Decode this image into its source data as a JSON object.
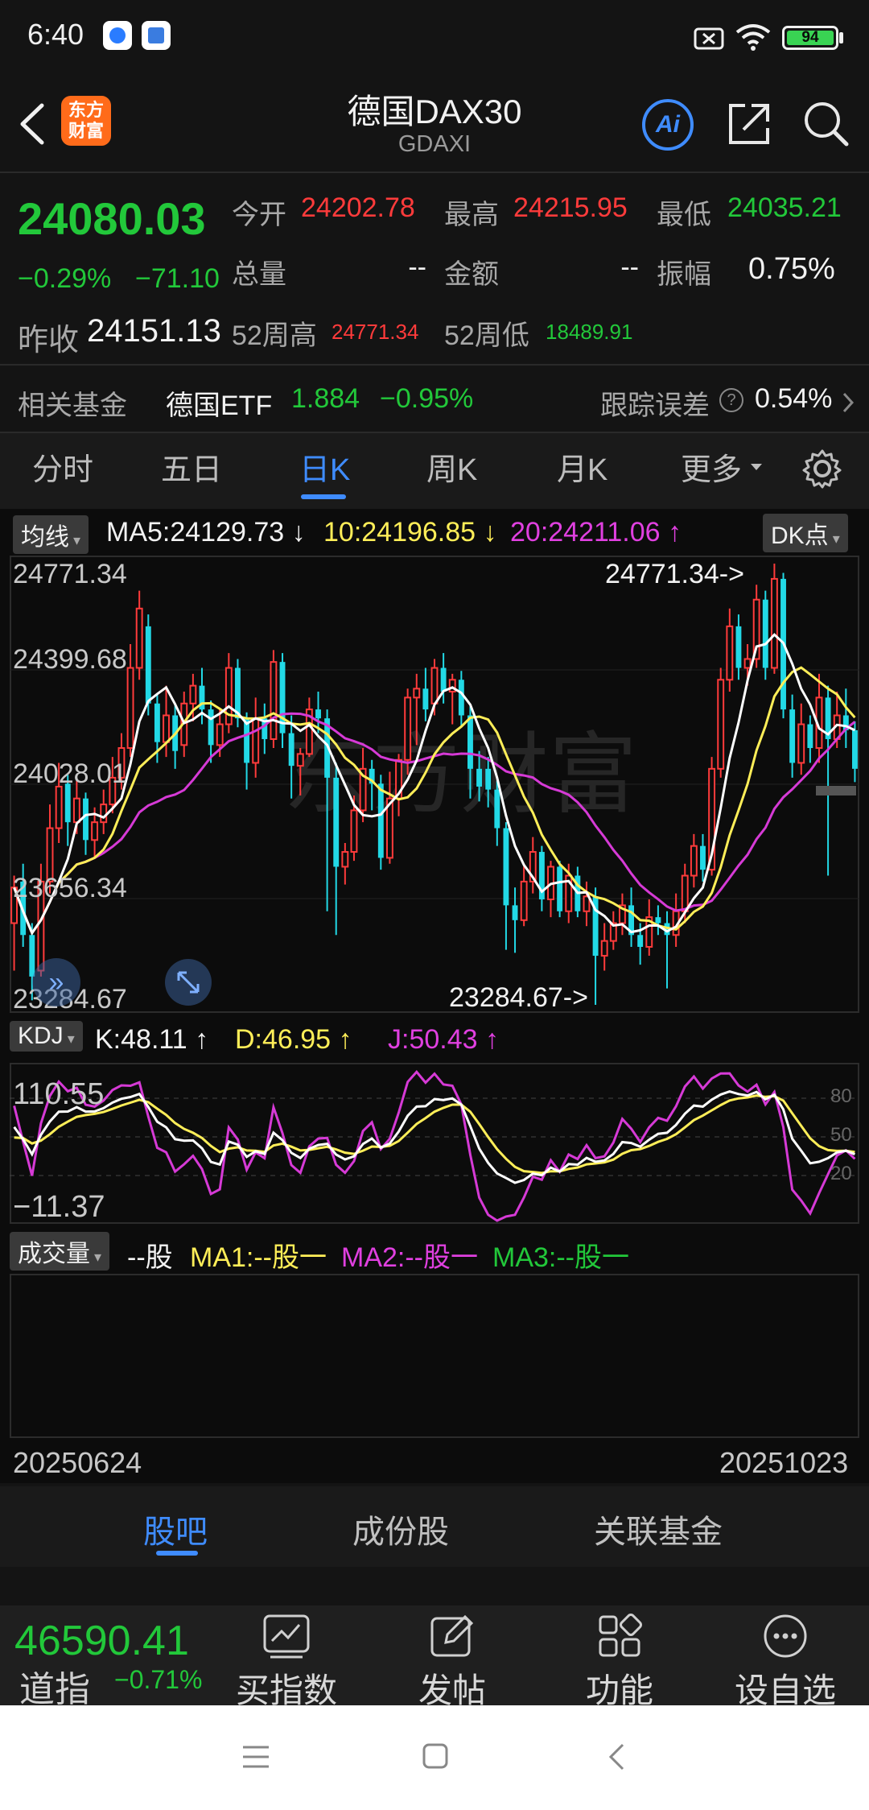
{
  "status_bar": {
    "time": "6:40",
    "battery": "94",
    "icons": [
      "sim-x-icon",
      "wifi-icon",
      "battery-icon"
    ]
  },
  "header": {
    "logo_text": "东方财富",
    "title": "德国DAX30",
    "subtitle": "GDAXI",
    "ai_label": "Ai",
    "icons": [
      "back-icon",
      "share-icon",
      "search-icon"
    ]
  },
  "quote": {
    "price": "24080.03",
    "change_pct": "−0.29%",
    "change": "−71.10",
    "prev_close_label": "昨收",
    "prev_close": "24151.13",
    "open_label": "今开",
    "open": "24202.78",
    "high_label": "最高",
    "high": "24215.95",
    "low_label": "最低",
    "low": "24035.21",
    "volume_label": "总量",
    "volume": "--",
    "amount_label": "金额",
    "amount": "--",
    "amplitude_label": "振幅",
    "amplitude": "0.75%",
    "w52_high_label": "52周高",
    "w52_high": "24771.34",
    "w52_low_label": "52周低",
    "w52_low": "18489.91"
  },
  "fund": {
    "label": "相关基金",
    "name": "德国ETF",
    "price": "1.884",
    "change": "−0.95%",
    "tracking_label": "跟踪误差",
    "tracking": "0.54%"
  },
  "period_tabs": {
    "items": [
      "分时",
      "五日",
      "日K",
      "周K",
      "月K",
      "更多"
    ],
    "active": "日K"
  },
  "kline": {
    "ma_selector": "均线",
    "ma5": "MA5:24129.73",
    "ma10": "10:24196.85",
    "ma20": "20:24211.06",
    "dk_button": "DK点",
    "y_labels": [
      "24771.34",
      "24399.68",
      "24028.01",
      "23656.34",
      "23284.67"
    ],
    "max_annot": "24771.34->",
    "min_annot": "23284.67->",
    "watermark": "东方财富",
    "colors": {
      "up": "#ff3b3b",
      "down": "#22d9e6",
      "ma5": "#ffffff",
      "ma10": "#ffee58",
      "ma20": "#d63ad6"
    }
  },
  "kdj": {
    "selector": "KDJ",
    "k": "K:48.11",
    "d": "D:46.95",
    "j": "J:50.43",
    "top": "110.55",
    "bottom": "−11.37",
    "levels": [
      "80",
      "50",
      "20"
    ]
  },
  "volume": {
    "selector": "成交量",
    "value": "--股",
    "ma1": "MA1:--股",
    "ma2": "MA2:--股",
    "ma3": "MA3:--股"
  },
  "date_axis": {
    "start": "20250624",
    "end": "20251023"
  },
  "bottom_tabs": {
    "items": [
      "股吧",
      "成份股",
      "关联基金"
    ],
    "active": "股吧"
  },
  "footer": {
    "index_value": "46590.41",
    "index_name": "道指",
    "index_change": "−0.71%",
    "buttons": [
      "买指数",
      "发帖",
      "功能",
      "设自选"
    ]
  },
  "chart_data": {
    "type": "candlestick",
    "ylim": [
      23284.67,
      24771.34
    ],
    "candles": [
      {
        "o": 23560,
        "c": 23680,
        "h": 23720,
        "l": 23400
      },
      {
        "o": 23700,
        "c": 23520,
        "h": 23760,
        "l": 23480
      },
      {
        "o": 23520,
        "c": 23380,
        "h": 23560,
        "l": 23300
      },
      {
        "o": 23400,
        "c": 23700,
        "h": 23760,
        "l": 23380
      },
      {
        "o": 23700,
        "c": 23880,
        "h": 23960,
        "l": 23660
      },
      {
        "o": 23880,
        "c": 24020,
        "h": 24100,
        "l": 23830
      },
      {
        "o": 24030,
        "c": 23900,
        "h": 24060,
        "l": 23820
      },
      {
        "o": 23900,
        "c": 23980,
        "h": 24040,
        "l": 23860
      },
      {
        "o": 23980,
        "c": 23840,
        "h": 24000,
        "l": 23790
      },
      {
        "o": 23840,
        "c": 23900,
        "h": 23950,
        "l": 23780
      },
      {
        "o": 23900,
        "c": 23960,
        "h": 24010,
        "l": 23860
      },
      {
        "o": 23960,
        "c": 24050,
        "h": 24120,
        "l": 23930
      },
      {
        "o": 24050,
        "c": 24150,
        "h": 24200,
        "l": 24010
      },
      {
        "o": 24150,
        "c": 24420,
        "h": 24500,
        "l": 24120
      },
      {
        "o": 24420,
        "c": 24620,
        "h": 24680,
        "l": 24380
      },
      {
        "o": 24560,
        "c": 24300,
        "h": 24600,
        "l": 24260
      },
      {
        "o": 24300,
        "c": 24170,
        "h": 24330,
        "l": 24100
      },
      {
        "o": 24170,
        "c": 24260,
        "h": 24360,
        "l": 24120
      },
      {
        "o": 24260,
        "c": 24140,
        "h": 24300,
        "l": 24080
      },
      {
        "o": 24160,
        "c": 24300,
        "h": 24340,
        "l": 24120
      },
      {
        "o": 24300,
        "c": 24360,
        "h": 24400,
        "l": 24240
      },
      {
        "o": 24360,
        "c": 24280,
        "h": 24420,
        "l": 24230
      },
      {
        "o": 24280,
        "c": 24160,
        "h": 24310,
        "l": 24100
      },
      {
        "o": 24160,
        "c": 24230,
        "h": 24280,
        "l": 24120
      },
      {
        "o": 24230,
        "c": 24420,
        "h": 24470,
        "l": 24200
      },
      {
        "o": 24420,
        "c": 24250,
        "h": 24450,
        "l": 24220
      },
      {
        "o": 24250,
        "c": 24100,
        "h": 24270,
        "l": 24010
      },
      {
        "o": 24100,
        "c": 24250,
        "h": 24320,
        "l": 24050
      },
      {
        "o": 24250,
        "c": 24180,
        "h": 24300,
        "l": 24130
      },
      {
        "o": 24180,
        "c": 24440,
        "h": 24480,
        "l": 24150
      },
      {
        "o": 24440,
        "c": 24200,
        "h": 24470,
        "l": 24150
      },
      {
        "o": 24200,
        "c": 24090,
        "h": 24260,
        "l": 23980
      },
      {
        "o": 24090,
        "c": 24130,
        "h": 24150,
        "l": 23990
      },
      {
        "o": 24130,
        "c": 24280,
        "h": 24320,
        "l": 24120
      },
      {
        "o": 24280,
        "c": 24250,
        "h": 24340,
        "l": 24200
      },
      {
        "o": 24250,
        "c": 24050,
        "h": 24280,
        "l": 23600
      },
      {
        "o": 24050,
        "c": 23750,
        "h": 24100,
        "l": 23520
      },
      {
        "o": 23750,
        "c": 23800,
        "h": 23830,
        "l": 23690
      },
      {
        "o": 23800,
        "c": 23940,
        "h": 23990,
        "l": 23770
      },
      {
        "o": 23940,
        "c": 24080,
        "h": 24150,
        "l": 23900
      },
      {
        "o": 24080,
        "c": 24030,
        "h": 24110,
        "l": 23940
      },
      {
        "o": 24030,
        "c": 23780,
        "h": 24060,
        "l": 23740
      },
      {
        "o": 23780,
        "c": 23980,
        "h": 24070,
        "l": 23760
      },
      {
        "o": 23980,
        "c": 24110,
        "h": 24130,
        "l": 23920
      },
      {
        "o": 24110,
        "c": 24320,
        "h": 24350,
        "l": 24060
      },
      {
        "o": 24320,
        "c": 24350,
        "h": 24400,
        "l": 24160
      },
      {
        "o": 24350,
        "c": 24280,
        "h": 24420,
        "l": 24240
      },
      {
        "o": 24300,
        "c": 24420,
        "h": 24450,
        "l": 24260
      },
      {
        "o": 24420,
        "c": 24340,
        "h": 24470,
        "l": 24300
      },
      {
        "o": 24340,
        "c": 24380,
        "h": 24400,
        "l": 24230
      },
      {
        "o": 24380,
        "c": 24260,
        "h": 24410,
        "l": 24220
      },
      {
        "o": 24260,
        "c": 24080,
        "h": 24290,
        "l": 23980
      },
      {
        "o": 24080,
        "c": 24020,
        "h": 24140,
        "l": 23970
      },
      {
        "o": 24080,
        "c": 24010,
        "h": 24120,
        "l": 23950
      },
      {
        "o": 24010,
        "c": 23880,
        "h": 24040,
        "l": 23820
      },
      {
        "o": 23880,
        "c": 23620,
        "h": 23900,
        "l": 23470
      },
      {
        "o": 23620,
        "c": 23570,
        "h": 23680,
        "l": 23460
      },
      {
        "o": 23570,
        "c": 23700,
        "h": 23760,
        "l": 23550
      },
      {
        "o": 23700,
        "c": 23800,
        "h": 23850,
        "l": 23660
      },
      {
        "o": 23800,
        "c": 23640,
        "h": 23820,
        "l": 23600
      },
      {
        "o": 23640,
        "c": 23750,
        "h": 23770,
        "l": 23580
      },
      {
        "o": 23750,
        "c": 23600,
        "h": 23770,
        "l": 23580
      },
      {
        "o": 23600,
        "c": 23720,
        "h": 23760,
        "l": 23560
      },
      {
        "o": 23720,
        "c": 23600,
        "h": 23750,
        "l": 23580
      },
      {
        "o": 23600,
        "c": 23650,
        "h": 23700,
        "l": 23550
      },
      {
        "o": 23650,
        "c": 23450,
        "h": 23680,
        "l": 23284.67
      },
      {
        "o": 23450,
        "c": 23500,
        "h": 23560,
        "l": 23400
      },
      {
        "o": 23500,
        "c": 23560,
        "h": 23600,
        "l": 23470
      },
      {
        "o": 23560,
        "c": 23620,
        "h": 23660,
        "l": 23520
      },
      {
        "o": 23620,
        "c": 23520,
        "h": 23680,
        "l": 23480
      },
      {
        "o": 23520,
        "c": 23480,
        "h": 23560,
        "l": 23420
      },
      {
        "o": 23480,
        "c": 23580,
        "h": 23640,
        "l": 23450
      },
      {
        "o": 23580,
        "c": 23560,
        "h": 23620,
        "l": 23520
      },
      {
        "o": 23560,
        "c": 23520,
        "h": 23600,
        "l": 23340
      },
      {
        "o": 23520,
        "c": 23600,
        "h": 23660,
        "l": 23480
      },
      {
        "o": 23600,
        "c": 23720,
        "h": 23760,
        "l": 23560
      },
      {
        "o": 23720,
        "c": 23820,
        "h": 23860,
        "l": 23680
      },
      {
        "o": 23820,
        "c": 23740,
        "h": 23860,
        "l": 23700
      },
      {
        "o": 23740,
        "c": 24080,
        "h": 24120,
        "l": 23720
      },
      {
        "o": 24080,
        "c": 24380,
        "h": 24420,
        "l": 24050
      },
      {
        "o": 24380,
        "c": 24560,
        "h": 24620,
        "l": 24340
      },
      {
        "o": 24560,
        "c": 24420,
        "h": 24600,
        "l": 24380
      },
      {
        "o": 24420,
        "c": 24450,
        "h": 24500,
        "l": 24360
      },
      {
        "o": 24450,
        "c": 24650,
        "h": 24700,
        "l": 24420
      },
      {
        "o": 24650,
        "c": 24420,
        "h": 24680,
        "l": 24380
      },
      {
        "o": 24420,
        "c": 24720,
        "h": 24771.34,
        "l": 24400
      },
      {
        "o": 24720,
        "c": 24280,
        "h": 24740,
        "l": 24250
      },
      {
        "o": 24280,
        "c": 24100,
        "h": 24330,
        "l": 24050
      },
      {
        "o": 24100,
        "c": 24230,
        "h": 24300,
        "l": 24060
      },
      {
        "o": 24230,
        "c": 24150,
        "h": 24260,
        "l": 24100
      },
      {
        "o": 24150,
        "c": 24320,
        "h": 24400,
        "l": 24100
      },
      {
        "o": 24320,
        "c": 24180,
        "h": 24360,
        "l": 23720
      },
      {
        "o": 24180,
        "c": 24260,
        "h": 24340,
        "l": 24150
      },
      {
        "o": 24260,
        "c": 24210,
        "h": 24350,
        "l": 24150
      },
      {
        "o": 24210,
        "c": 24080,
        "h": 24240,
        "l": 24035
      }
    ]
  }
}
